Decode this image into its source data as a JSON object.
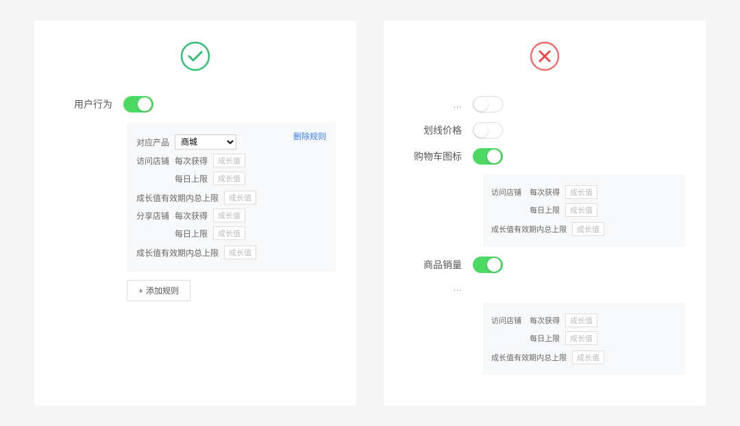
{
  "panels": {
    "good": {
      "indicator": "checkmark",
      "toggle": {
        "label": "用户行为",
        "on": true
      },
      "rule_box": {
        "delete_label": "删除规则",
        "product_label": "对应产品",
        "product_value": "商城",
        "sections": [
          {
            "name": "访问店铺",
            "lines": [
              {
                "inline_label": "每次获得",
                "placeholder": "成长值"
              },
              {
                "inline_label": "每日上限",
                "placeholder": "成长值",
                "extra_label": "成长值有效期内总上限",
                "extra_placeholder": "成长值"
              }
            ]
          },
          {
            "name": "分享店铺",
            "lines": [
              {
                "inline_label": "每次获得",
                "placeholder": "成长值"
              },
              {
                "inline_label": "每日上限",
                "placeholder": "成长值",
                "extra_label": "成长值有效期内总上限",
                "extra_placeholder": "成长值"
              }
            ]
          }
        ]
      },
      "add_rule_label": "添加规则"
    },
    "bad": {
      "indicator": "cross",
      "rows": [
        {
          "label": "…",
          "on": false
        },
        {
          "label": "划线价格",
          "on": false
        },
        {
          "label": "购物车图标",
          "on": true
        },
        {
          "label": "商品销量",
          "on": true
        },
        {
          "label": "…",
          "on": false,
          "noToggle": true
        }
      ],
      "small_boxes": [
        {
          "section_name": "访问店铺",
          "lines": [
            {
              "inline_label": "每次获得",
              "placeholder": "成长值"
            },
            {
              "inline_label": "每日上限",
              "placeholder": "成长值",
              "extra_label": "成长值有效期内总上限",
              "extra_placeholder": "成长值"
            }
          ]
        },
        {
          "section_name": "访问店铺",
          "lines": [
            {
              "inline_label": "每次获得",
              "placeholder": "成长值"
            },
            {
              "inline_label": "每日上限",
              "placeholder": "成长值",
              "extra_label": "成长值有效期内总上限",
              "extra_placeholder": "成长值"
            }
          ]
        }
      ]
    }
  }
}
